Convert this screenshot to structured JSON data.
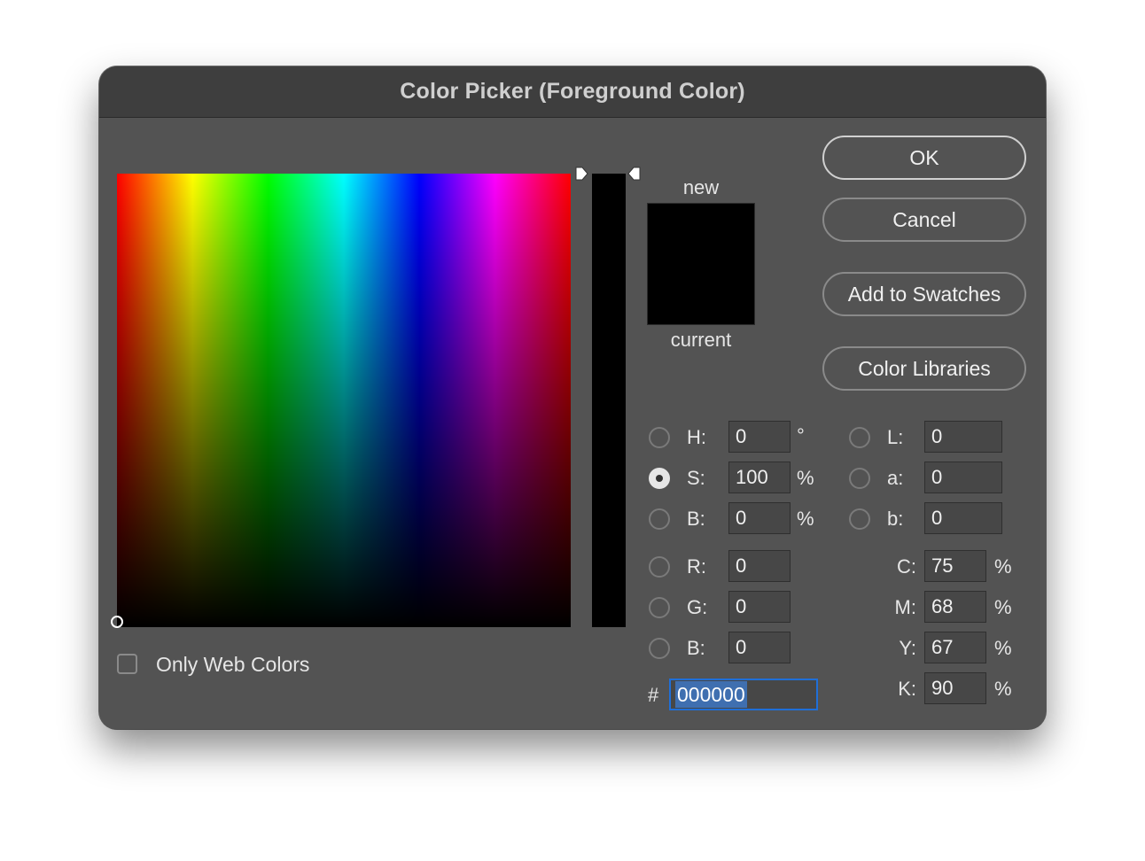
{
  "window": {
    "title": "Color Picker (Foreground Color)"
  },
  "swatch": {
    "new_label": "new",
    "current_label": "current",
    "new_color": "#000000",
    "current_color": "#000000"
  },
  "buttons": {
    "ok": "OK",
    "cancel": "Cancel",
    "add_to_swatches": "Add to Swatches",
    "color_libraries": "Color Libraries"
  },
  "hsb": {
    "h": {
      "label": "H:",
      "value": "0",
      "unit": "°"
    },
    "s": {
      "label": "S:",
      "value": "100",
      "unit": "%",
      "selected": true
    },
    "b": {
      "label": "B:",
      "value": "0",
      "unit": "%"
    }
  },
  "rgb": {
    "r": {
      "label": "R:",
      "value": "0"
    },
    "g": {
      "label": "G:",
      "value": "0"
    },
    "b": {
      "label": "B:",
      "value": "0"
    }
  },
  "lab": {
    "l": {
      "label": "L:",
      "value": "0"
    },
    "a": {
      "label": "a:",
      "value": "0"
    },
    "b": {
      "label": "b:",
      "value": "0"
    }
  },
  "cmyk": {
    "c": {
      "label": "C:",
      "value": "75",
      "unit": "%"
    },
    "m": {
      "label": "M:",
      "value": "68",
      "unit": "%"
    },
    "y": {
      "label": "Y:",
      "value": "67",
      "unit": "%"
    },
    "k": {
      "label": "K:",
      "value": "90",
      "unit": "%"
    }
  },
  "hex": {
    "label": "#",
    "value": "000000"
  },
  "options": {
    "only_web_colors": "Only Web Colors",
    "only_web_colors_checked": false
  }
}
